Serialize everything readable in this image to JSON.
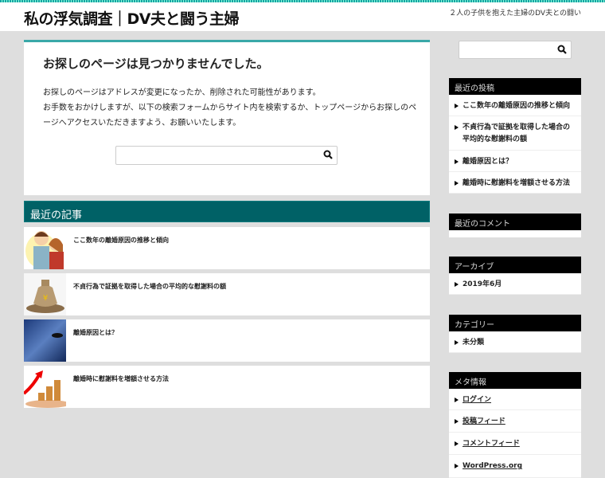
{
  "header": {
    "title": "私の浮気調査｜DV夫と闘う主婦",
    "tagline": "２人の子供を抱えた主婦のDV夫との闘い"
  },
  "main": {
    "heading": "お探しのページは見つかりませんでした。",
    "lines": [
      "お探しのページはアドレスが変更になったか、削除された可能性があります。",
      "お手数をおかけしますが、以下の検索フォームからサイト内を検索するか、トップページからお探しのページへアクセスいただきますよう、お願いいたします。"
    ],
    "search_placeholder": ""
  },
  "recent": {
    "heading": "最近の記事",
    "items": [
      "ここ数年の離婚原因の推移と傾向",
      "不貞行為で証拠を取得した場合の平均的な慰謝料の額",
      "離婚原因とは？",
      "離婚時に慰謝料を増額させる方法"
    ]
  },
  "sidebar": {
    "recent_posts": {
      "title": "最近の投稿",
      "items": [
        "ここ数年の離婚原因の推移と傾向",
        "不貞行為で証拠を取得した場合の平均的な慰謝料の額",
        "離婚原因とは？",
        "離婚時に慰謝料を増額させる方法"
      ]
    },
    "recent_comments": {
      "title": "最近のコメント"
    },
    "archive": {
      "title": "アーカイブ",
      "items": [
        "2019年6月"
      ]
    },
    "categories": {
      "title": "カテゴリー",
      "items": [
        "未分類"
      ]
    },
    "meta": {
      "title": "メタ情報",
      "items": [
        "ログイン",
        "投稿フィード",
        "コメントフィード",
        "WordPress.org"
      ]
    }
  },
  "colors": {
    "accent": "#006166",
    "teal_border": "#3aa8a8"
  }
}
